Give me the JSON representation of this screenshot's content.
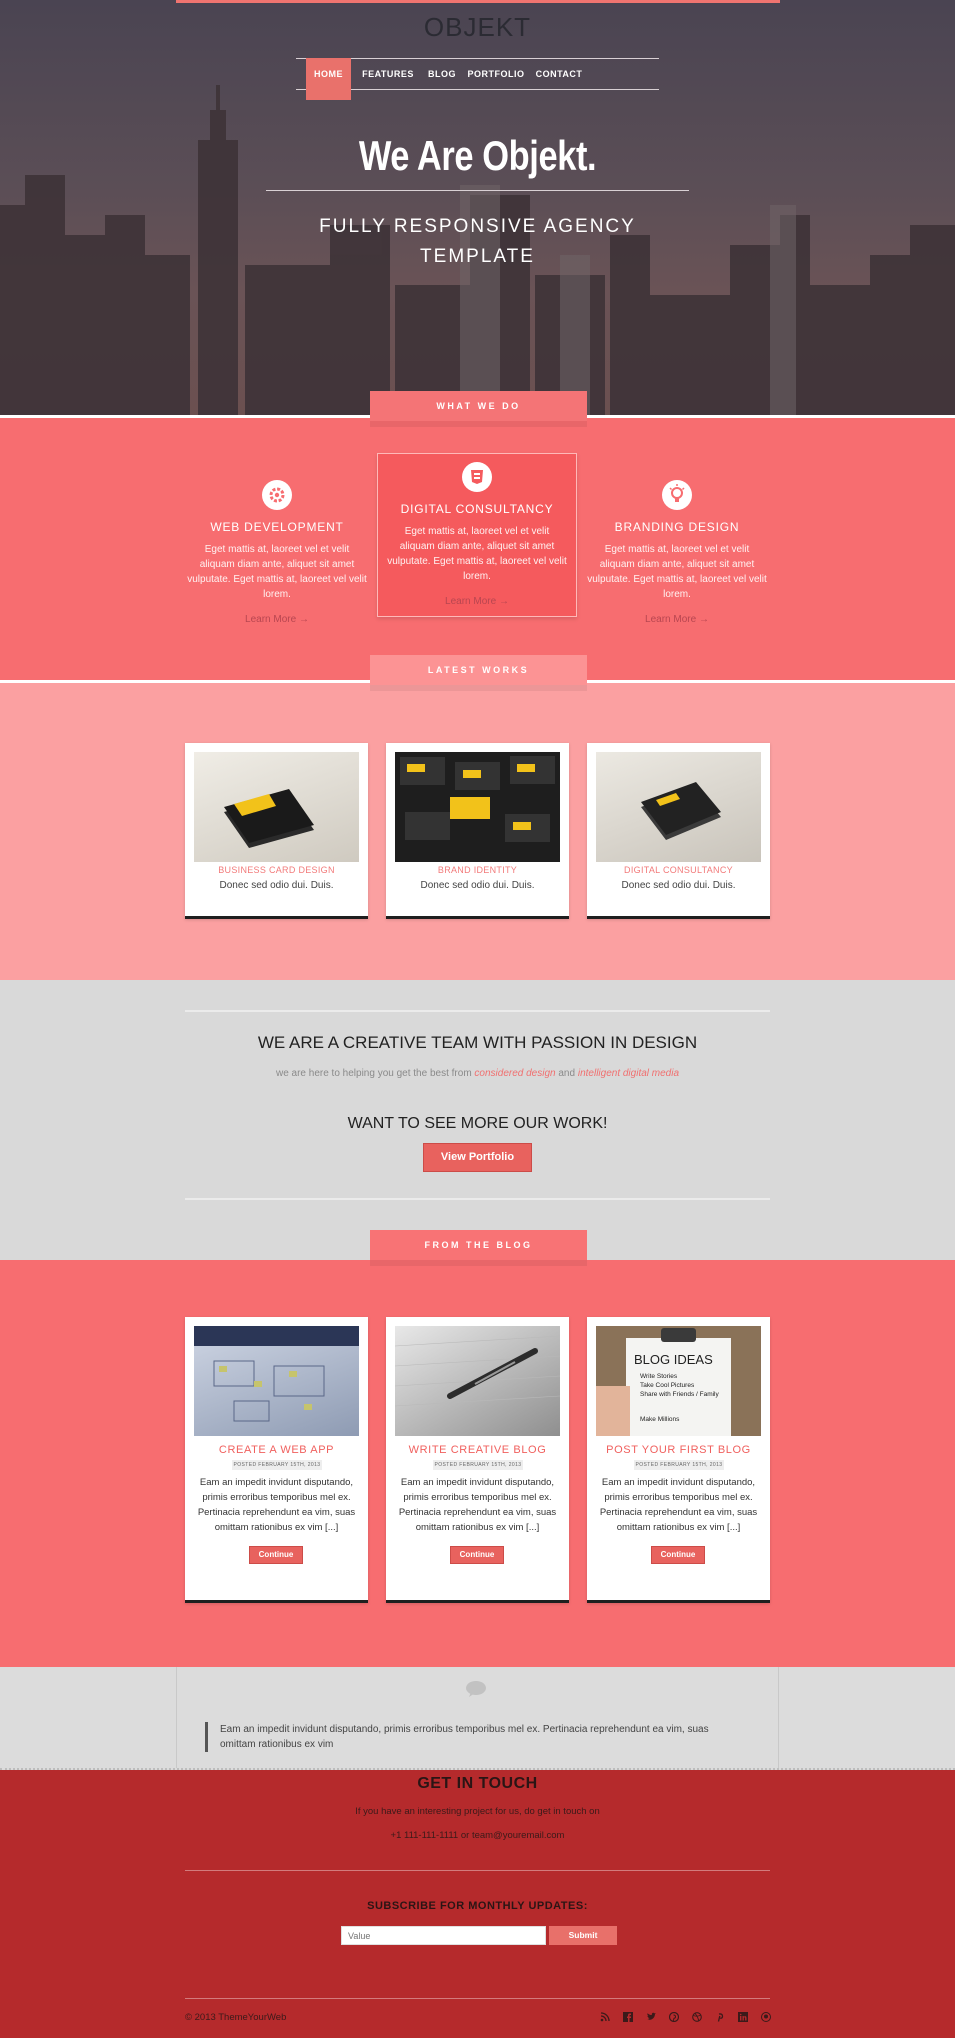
{
  "brand": "OBJEKT",
  "nav": {
    "items": [
      {
        "label": "HOME",
        "active": true
      },
      {
        "label": "FEATURES",
        "active": false
      },
      {
        "label": "BLOG",
        "active": false
      },
      {
        "label": "PORTFOLIO",
        "active": false
      },
      {
        "label": "CONTACT",
        "active": false
      }
    ]
  },
  "hero": {
    "title": "We Are Objekt.",
    "subtitle_line1": "FULLY RESPONSIVE AGENCY",
    "subtitle_line2": "TEMPLATE"
  },
  "what_we_do": {
    "heading": "WHAT WE DO",
    "services": [
      {
        "icon": "gear-icon",
        "title": "WEB DEVELOPMENT",
        "text": "Eget mattis at, laoreet vel et velit aliquam diam ante, aliquet sit amet vulputate. Eget mattis at, laoreet vel velit lorem.",
        "link": "Learn More →"
      },
      {
        "icon": "html5-icon",
        "title": "DIGITAL CONSULTANCY",
        "text": "Eget mattis at, laoreet vel et velit aliquam diam ante, aliquet sit amet vulputate. Eget mattis at, laoreet vel velit lorem.",
        "link": "Learn More →"
      },
      {
        "icon": "lightbulb-icon",
        "title": "BRANDING DESIGN",
        "text": "Eget mattis at, laoreet vel et velit aliquam diam ante, aliquet sit amet vulputate. Eget mattis at, laoreet vel velit lorem.",
        "link": "Learn More →"
      }
    ]
  },
  "latest_works": {
    "heading": "LATEST WORKS",
    "items": [
      {
        "title": "BUSINESS CARD DESIGN",
        "subtitle": "Donec sed odio dui. Duis."
      },
      {
        "title": "BRAND IDENTITY",
        "subtitle": "Donec sed odio dui. Duis."
      },
      {
        "title": "DIGITAL CONSULTANCY",
        "subtitle": "Donec sed odio dui. Duis."
      }
    ]
  },
  "team": {
    "title": "WE ARE A CREATIVE TEAM WITH PASSION IN DESIGN",
    "sub_prefix": "we are here to helping you get the best from ",
    "sub_em1": "considered design",
    "sub_and": " and ",
    "sub_em2": "intelligent digital media",
    "cta": "WANT TO SEE MORE OUR WORK!",
    "button": "View Portfolio"
  },
  "blog": {
    "heading": "FROM THE BLOG",
    "posts": [
      {
        "title": "CREATE A WEB APP",
        "date": "POSTED FEBRUARY 15TH, 2013",
        "text": "Eam an impedit invidunt disputando, primis erroribus temporibus mel ex. Pertinacia reprehendunt ea vim, suas omittam rationibus ex vim [...]",
        "button": "Continue"
      },
      {
        "title": "WRITE CREATIVE BLOG",
        "date": "POSTED FEBRUARY 15TH, 2013",
        "text": "Eam an impedit invidunt disputando, primis erroribus temporibus mel ex. Pertinacia reprehendunt ea vim, suas omittam rationibus ex vim [...]",
        "button": "Continue"
      },
      {
        "title": "POST YOUR FIRST BLOG",
        "date": "POSTED FEBRUARY 15TH, 2013",
        "text": "Eam an impedit invidunt disputando, primis erroribus temporibus mel ex. Pertinacia reprehendunt ea vim, suas omittam rationibus ex vim [...]",
        "button": "Continue"
      }
    ],
    "clipboard": {
      "heading": "BLOG IDEAS",
      "items": [
        "Write Stories",
        "Take Cool Pictures",
        "Share with Friends / Family",
        "Make Millions"
      ]
    }
  },
  "testimonial": {
    "quote": "Eam an impedit invidunt disputando, primis erroribus temporibus mel ex. Pertinacia reprehendunt ea vim, suas omittam rationibus ex vim"
  },
  "footer": {
    "title": "GET IN TOUCH",
    "text": "If you have an interesting project for us, do get in touch on",
    "contact": "+1 111-111-1111 or team@youremail.com",
    "subscribe_title": "SUBSCRIBE FOR MONTHLY UPDATES:",
    "input_placeholder": "Value",
    "submit": "Submit",
    "copyright": "© 2013 ThemeYourWeb",
    "social": [
      "rss-icon",
      "facebook-icon",
      "twitter-icon",
      "pinterest-icon",
      "dribbble-icon",
      "pinterest-p-icon",
      "linkedin-icon",
      "github-icon"
    ]
  },
  "colors": {
    "accent": "#f76d70",
    "light_pink": "#fba0a1",
    "dark_red": "#b52a2c",
    "button": "#e8625e"
  }
}
